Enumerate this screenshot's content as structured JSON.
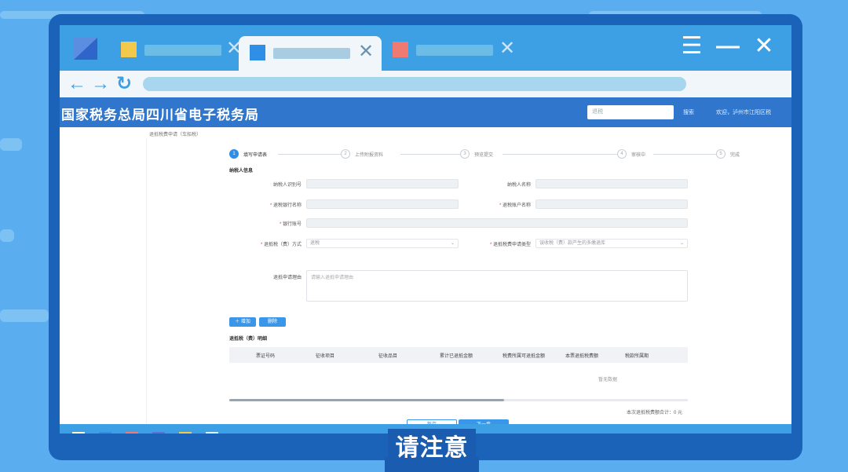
{
  "browser": {
    "tabs": [
      {
        "color": "#f2c94c",
        "active": false
      },
      {
        "color": "#2f8ee6",
        "active": true
      },
      {
        "color": "#ef7a72",
        "active": false
      }
    ],
    "window_controls": {
      "menu": "☰",
      "minimize": "—",
      "close": "✕"
    },
    "nav": {
      "back": "←",
      "forward": "→",
      "reload": "↻"
    }
  },
  "site": {
    "title": "国家税务总局四川省电子税务局",
    "search_placeholder": "退税",
    "search_button": "搜索",
    "welcome": "欢迎，泸州市江阳区税"
  },
  "page": {
    "breadcrumb": "退抵税费申请（车船税）",
    "steps": [
      {
        "num": "1",
        "label": "填写申请表",
        "active": true
      },
      {
        "num": "2",
        "label": "上传附报资料",
        "active": false
      },
      {
        "num": "3",
        "label": "预览提交",
        "active": false
      },
      {
        "num": "4",
        "label": "审核中",
        "active": false
      },
      {
        "num": "5",
        "label": "完成",
        "active": false
      }
    ],
    "section_taxpayer": "纳税人信息",
    "fields": {
      "taxpayer_id_label": "纳税人识别号",
      "taxpayer_name_label": "纳税人名称",
      "refund_bank_label": "退税银行名称",
      "refund_account_name_label": "退税账户名称",
      "bank_account_label": "银行账号",
      "refund_method_label": "退抵税（费）方式",
      "refund_method_value": "退税",
      "refund_type_label": "退抵税费申请类型",
      "refund_type_value": "误收税（费）款产生的多缴退库",
      "reason_label": "退抵申请理由",
      "reason_placeholder": "请输入退抵申请理由"
    },
    "buttons": {
      "add": "＋ 增加",
      "delete": "删除",
      "save": "暂存",
      "next": "下一步"
    },
    "section_detail": "退抵税（费）明细",
    "table_headers": [
      "票证号码",
      "征收项目",
      "征收品目",
      "累计已退抵金额",
      "税费所属可退抵金额",
      "本票退抵税费额",
      "税款所属期"
    ],
    "empty_text": "暂无数据",
    "total_text": "本次退抵税费额合计：0 元"
  },
  "dock": {
    "left_colors": [
      "#fff7c6",
      "#2f8ee6",
      "#ef7a72",
      "#5b6fd6",
      "#f2c94c",
      "#d7f3fa"
    ],
    "right_colors": [
      "#fff7c6",
      "#6ccf7a",
      "#f07c9a",
      "#5b6fd6",
      "#fff7c6",
      "#d7f3fa"
    ]
  },
  "caption": "请注意"
}
